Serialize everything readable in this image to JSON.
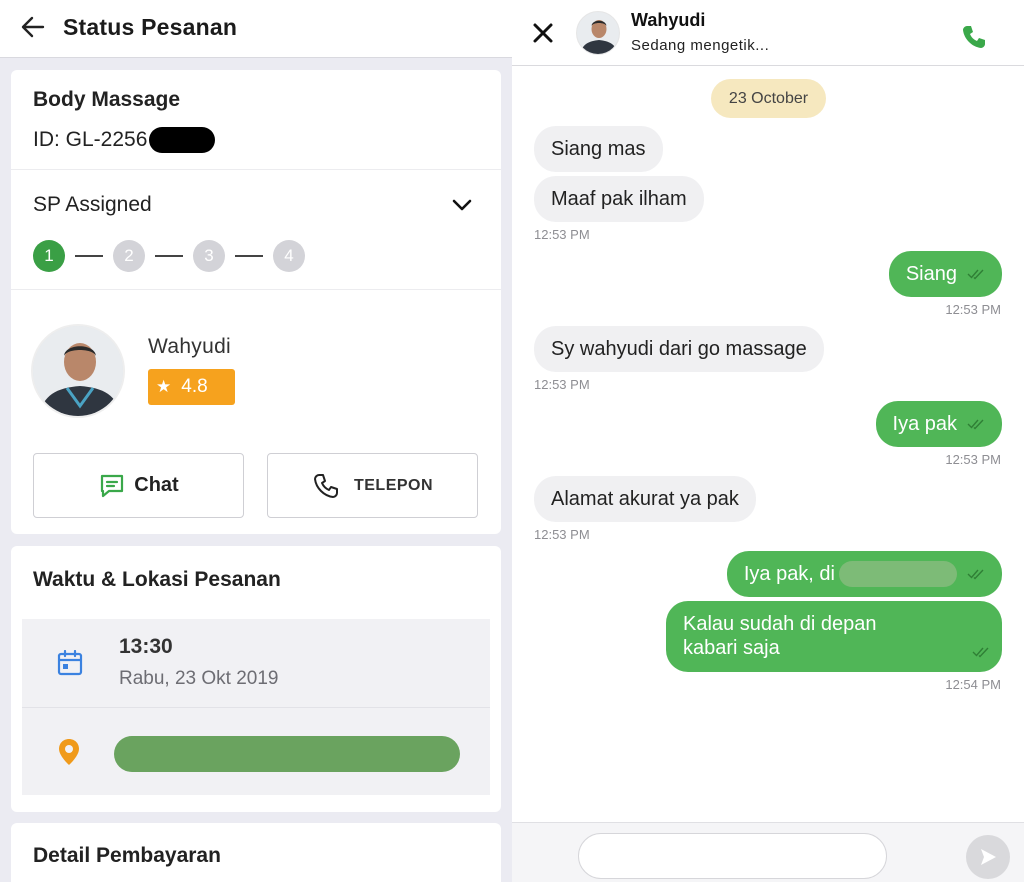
{
  "order": {
    "header_title": "Status Pesanan",
    "service_name": "Body Massage",
    "order_id": "ID: GL-2256",
    "status": "SP Assigned",
    "steps": [
      "1",
      "2",
      "3",
      "4"
    ],
    "active_step": 1,
    "provider": {
      "name": "Wahyudi",
      "rating": "4.8"
    },
    "buttons": {
      "chat": "Chat",
      "telepon": "TELEPON"
    },
    "schedule_section": {
      "title": "Waktu & Lokasi Pesanan",
      "time": "13:30",
      "date": "Rabu, 23 Okt 2019"
    },
    "payment_section": {
      "title": "Detail Pembayaran"
    }
  },
  "chat": {
    "contact_name": "Wahyudi",
    "contact_status": "Sedang mengetik...",
    "date_chip": "23 October",
    "messages": [
      {
        "dir": "in",
        "text": "Siang mas"
      },
      {
        "dir": "in",
        "text": "Maaf pak ilham",
        "time": "12:53 PM"
      },
      {
        "dir": "out",
        "text": "Siang",
        "time": "12:53 PM"
      },
      {
        "dir": "in",
        "text": "Sy wahyudi dari go massage",
        "time": "12:53 PM"
      },
      {
        "dir": "out",
        "text": "Iya pak",
        "time": "12:53 PM"
      },
      {
        "dir": "in",
        "text": "Alamat akurat ya pak",
        "time": "12:53 PM"
      },
      {
        "dir": "out",
        "text": "Iya pak, di"
      },
      {
        "dir": "out",
        "text_line1": "Kalau sudah di depan",
        "text_line2": "kabari saja",
        "time": "12:54 PM"
      }
    ],
    "input_placeholder": ""
  },
  "colors": {
    "brand_green": "#50b657",
    "step_active": "#3a9f45",
    "rating_orange": "#f6a21e",
    "date_chip": "#f6e8bf",
    "incoming_bubble": "#f0f0f2"
  },
  "icons": [
    "back-arrow-icon",
    "chevron-down-icon",
    "star-icon",
    "chat-icon",
    "phone-icon",
    "calendar-icon",
    "location-pin-icon",
    "close-icon",
    "call-icon",
    "double-check-icon",
    "send-icon"
  ]
}
